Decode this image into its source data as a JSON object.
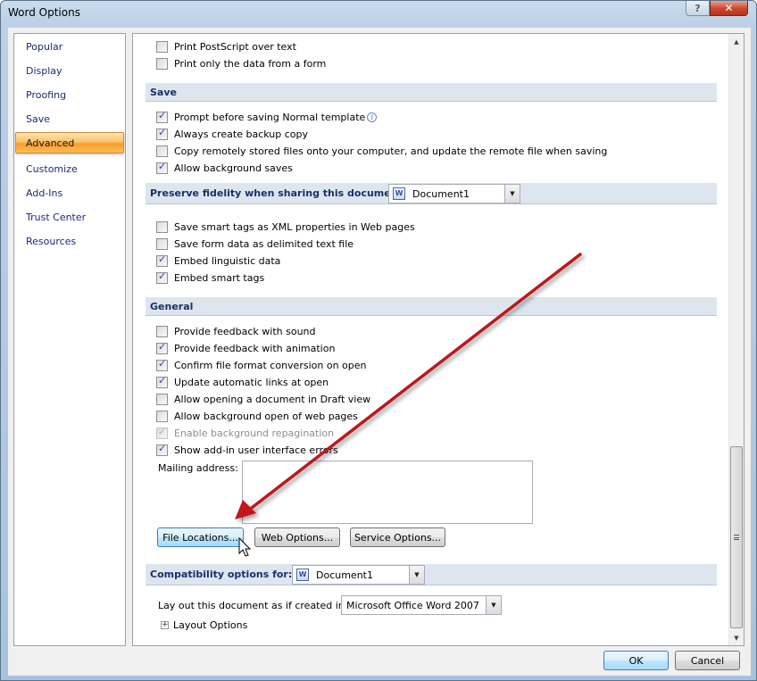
{
  "window": {
    "title": "Word Options",
    "help_icon": "help-icon",
    "close_icon": "close-icon"
  },
  "sidebar": {
    "items": [
      {
        "label": "Popular",
        "active": false
      },
      {
        "label": "Display",
        "active": false
      },
      {
        "label": "Proofing",
        "active": false
      },
      {
        "label": "Save",
        "active": false
      },
      {
        "label": "Advanced",
        "active": true
      },
      {
        "label": "Customize",
        "active": false
      },
      {
        "label": "Add-Ins",
        "active": false
      },
      {
        "label": "Trust Center",
        "active": false
      },
      {
        "label": "Resources",
        "active": false
      }
    ]
  },
  "print_options": [
    {
      "label": "Print PostScript over text",
      "mnemonic": "P",
      "checked": false
    },
    {
      "label": "Print only the data from a form",
      "mnemonic": "d",
      "checked": false
    }
  ],
  "save_section": {
    "title": "Save",
    "options": [
      {
        "label": "Prompt before saving Normal template",
        "checked": true,
        "info_icon": "info-icon"
      },
      {
        "label": "Always create backup copy",
        "checked": true
      },
      {
        "label": "Copy remotely stored files onto your computer, and update the remote file when saving",
        "checked": false
      },
      {
        "label": "Allow background saves",
        "checked": true
      }
    ]
  },
  "fidelity_section": {
    "title": "Preserve fidelity when sharing this document:",
    "document_select": "Document1",
    "options": [
      {
        "label": "Save smart tags as XML properties in Web pages",
        "checked": false
      },
      {
        "label": "Save form data as delimited text file",
        "checked": false
      },
      {
        "label": "Embed linguistic data",
        "checked": true
      },
      {
        "label": "Embed smart tags",
        "checked": true
      }
    ]
  },
  "general_section": {
    "title": "General",
    "options": [
      {
        "label": "Provide feedback with sound",
        "checked": false,
        "disabled": false
      },
      {
        "label": "Provide feedback with animation",
        "checked": true,
        "disabled": false
      },
      {
        "label": "Confirm file format conversion on open",
        "checked": true,
        "disabled": false
      },
      {
        "label": "Update automatic links at open",
        "checked": true,
        "disabled": false
      },
      {
        "label": "Allow opening a document in Draft view",
        "checked": false,
        "disabled": false
      },
      {
        "label": "Allow background open of web pages",
        "checked": false,
        "disabled": false
      },
      {
        "label": "Enable background repagination",
        "checked": true,
        "disabled": true
      },
      {
        "label": "Show add-in user interface errors",
        "checked": true,
        "disabled": false
      }
    ],
    "mailing_address_label": "Mailing address:",
    "mailing_address_value": "",
    "buttons": {
      "file_locations": "File Locations...",
      "web_options": "Web Options...",
      "service_options": "Service Options..."
    }
  },
  "compatibility_section": {
    "title": "Compatibility options for:",
    "document_select": "Document1",
    "layout_label": "Lay out this document as if created in:",
    "layout_select": "Microsoft Office Word 2007",
    "layout_options_label": "Layout Options"
  },
  "footer": {
    "ok": "OK",
    "cancel": "Cancel"
  },
  "annotation": {
    "arrow_color": "#c0141b",
    "arrow_target": "File Locations..."
  }
}
